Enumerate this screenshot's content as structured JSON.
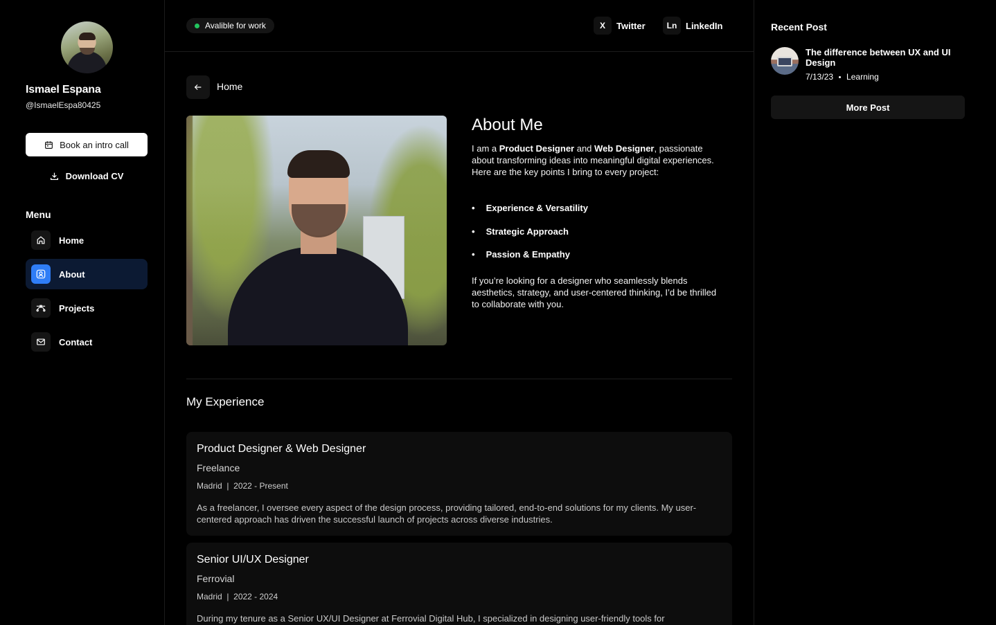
{
  "profile": {
    "name": "Ismael Espana",
    "handle": "@IsmaelEspa80425",
    "book_label": "Book an intro call",
    "download_label": "Download CV"
  },
  "menu": {
    "title": "Menu",
    "items": [
      {
        "label": "Home",
        "icon": "home-icon",
        "active": false
      },
      {
        "label": "About",
        "icon": "user-icon",
        "active": true
      },
      {
        "label": "Projects",
        "icon": "bezier-icon",
        "active": false
      },
      {
        "label": "Contact",
        "icon": "mail-icon",
        "active": false
      }
    ]
  },
  "topbar": {
    "status": "Avalible for work",
    "status_color": "#22c55e",
    "links": [
      {
        "icon_text": "X",
        "label": "Twitter"
      },
      {
        "icon_text": "Ln",
        "label": "LinkedIn"
      }
    ]
  },
  "breadcrumb": {
    "label": "Home"
  },
  "about": {
    "title": "About Me",
    "intro_1": "I am a ",
    "role_a": "Product Designer",
    "intro_2": " and ",
    "role_b": "Web Designer",
    "intro_3": ", passionate about transforming ideas into meaningful digital experiences. Here are the key points I bring to every project:",
    "points": [
      "Experience & Versatility",
      "Strategic Approach",
      "Passion & Empathy"
    ],
    "outro": "If you’re looking for a designer who seamlessly blends aesthetics, strategy, and user-centered thinking, I’d be thrilled to collaborate with you."
  },
  "experience": {
    "title": "My Experience",
    "items": [
      {
        "role": "Product Designer & Web Designer",
        "company": "Freelance",
        "location": "Madrid",
        "period": "2022 - Present",
        "description": "As a freelancer, I oversee every aspect of the design process, providing tailored, end-to-end solutions for my clients. My user-centered approach has driven the successful launch of projects across diverse industries."
      },
      {
        "role": "Senior UI/UX Designer",
        "company": "Ferrovial",
        "location": "Madrid",
        "period": "2022 - 2024",
        "description": "During my tenure as a Senior UX/UI Designer at Ferrovial Digital Hub, I specialized in designing user-friendly tools for"
      }
    ]
  },
  "recent": {
    "title": "Recent Post",
    "post_title": "The difference between UX and UI Design",
    "post_date": "7/13/23",
    "post_category": "Learning",
    "more_label": "More Post"
  },
  "accent_color": "#2f7df6"
}
